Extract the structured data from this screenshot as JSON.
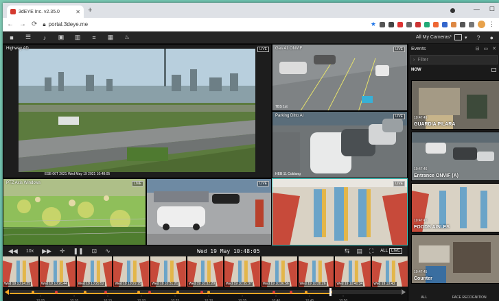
{
  "browser": {
    "tab_title": "3dEYE Inc. v2.35.0",
    "url": "portal.3deye.me"
  },
  "appbar": {
    "cameras_label": "All My Cameras*",
    "icons": [
      "video-icon",
      "list-icon",
      "bell-icon",
      "clip-icon",
      "map-icon",
      "menu-icon",
      "grid-icon",
      "fire-icon"
    ]
  },
  "cameras": [
    {
      "label": "Highway AD",
      "live": "LIVE",
      "ts": "ESB 06T 2021 Wed May 19 2021 10:48:05"
    },
    {
      "label": "Gas 41 ONVIF",
      "live": "LIVE",
      "ts": "TBS 1st"
    },
    {
      "label": "Parking Ditto AI",
      "live": "LIVE",
      "ts": "HEB 11 Coblang"
    },
    {
      "label": "PTZ Axis Windows",
      "live": "LIVE",
      "ts": ""
    },
    {
      "label": "",
      "live": "LIVE",
      "ts": ""
    },
    {
      "label": "",
      "live": "LIVE",
      "ts": ""
    }
  ],
  "controls": {
    "speed": "10x",
    "time": "Wed 19 May 10:48:05",
    "all_label": "ALL",
    "live_label": "LIVE"
  },
  "filmstrip": [
    "Wed 19 10:24:25",
    "Wed 19 10:26:44",
    "Wed 19 10:29:52",
    "Wed 19 10:29:15",
    "Wed 19 10:31:21",
    "Wed 19 10:32:29",
    "Wed 19 10:35:37",
    "Wed 19 10:36:56",
    "Wed 19 10:38:26",
    "Wed 19 10:40:34",
    "Wed 19 10:43:"
  ],
  "timeline": {
    "ticks": [
      "10:05",
      "10:10",
      "10:15",
      "10:20",
      "10:25",
      "10:30",
      "10:35",
      "10:40",
      "10:45",
      "10:50"
    ]
  },
  "events": {
    "title": "Events",
    "filter_placeholder": "Filter",
    "now_label": "NOW",
    "items": [
      {
        "time": "10:47:49",
        "title": "GUARDIA PILARA"
      },
      {
        "time": "10:47:46",
        "title": "Entrance ONVIF (A)"
      },
      {
        "time": "10:47:45",
        "title": "FOODS AISLES"
      },
      {
        "time": "10:47:45",
        "title": "Counter"
      }
    ],
    "footer_all": "ALL",
    "footer_face": "FACE RECOGNITION"
  },
  "colors": {
    "accent": "#f5a623",
    "highlight_border": "#3ec6c0",
    "event_dot": "#e03a3a"
  }
}
